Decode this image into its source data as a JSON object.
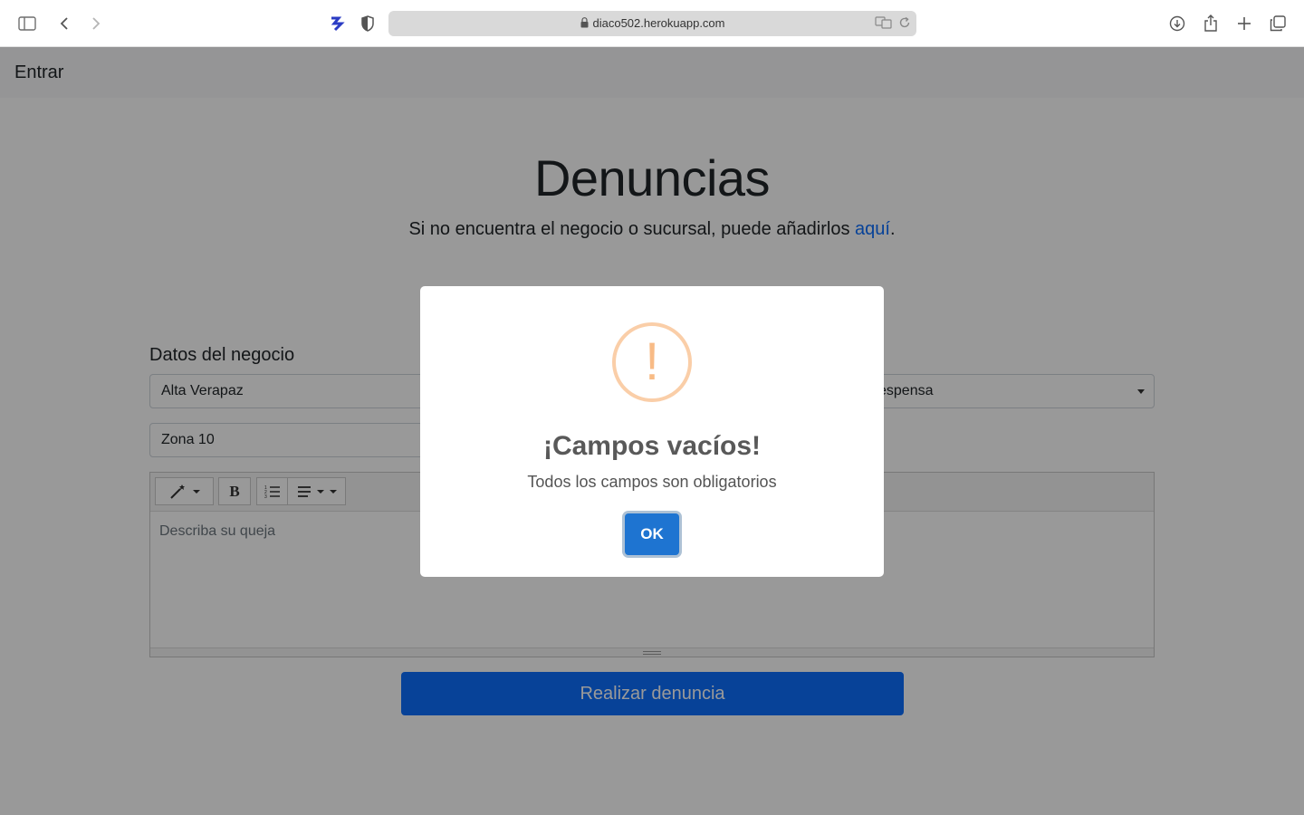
{
  "browser": {
    "url": "diaco502.herokuapp.com"
  },
  "navbar": {
    "brand": "Entrar"
  },
  "main": {
    "title": "Denuncias",
    "subtitle_prefix": "Si no encuentra el negocio o sucursal, puede añadirlos ",
    "subtitle_link": "aquí",
    "subtitle_suffix": "."
  },
  "form": {
    "section_title": "Datos del negocio",
    "department_value": "Alta Verapaz",
    "business_value": "espensa",
    "zone_value": "Zona 10",
    "editor_placeholder": "Describa su queja",
    "submit_label": "Realizar denuncia"
  },
  "modal": {
    "title": "¡Campos vacíos!",
    "text": "Todos los campos son obligatorios",
    "ok_label": "OK",
    "icon_glyph": "!",
    "icon_color": "#f8bb86"
  },
  "colors": {
    "primary": "#0d6efd",
    "ok_button": "#1e74d1"
  }
}
